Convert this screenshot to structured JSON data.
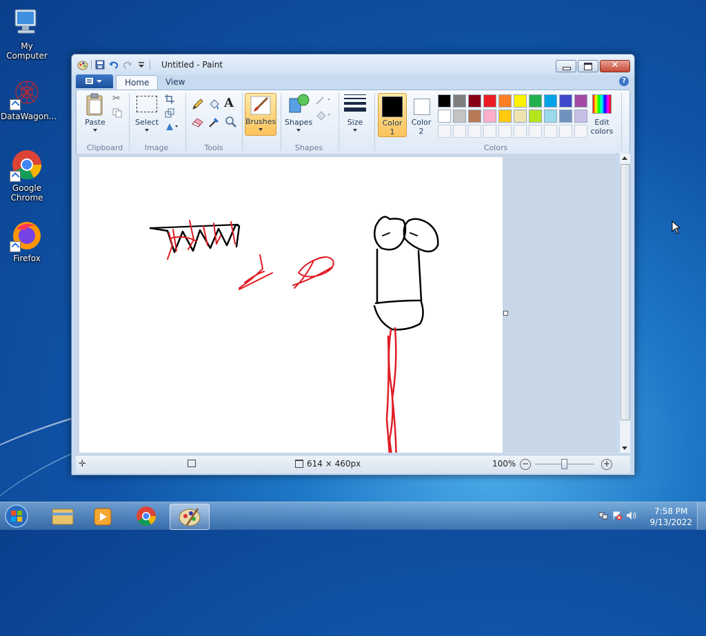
{
  "desktop": {
    "icons": [
      {
        "label": "My Computer",
        "icon": "computer-icon"
      },
      {
        "label": "DataWagon...",
        "icon": "datawagon-icon"
      },
      {
        "label": "Google Chrome",
        "icon": "chrome-icon"
      },
      {
        "label": "Firefox",
        "icon": "firefox-icon"
      }
    ]
  },
  "window": {
    "title": "Untitled - Paint",
    "tabs": [
      "Home",
      "View"
    ],
    "active_tab": "Home"
  },
  "ribbon": {
    "clipboard": {
      "paste": "Paste",
      "group": "Clipboard"
    },
    "image": {
      "select": "Select",
      "group": "Image"
    },
    "tools": {
      "group": "Tools"
    },
    "brushes": "Brushes",
    "shapes": {
      "label": "Shapes",
      "group": "Shapes"
    },
    "size": "Size",
    "color1": {
      "line1": "Color",
      "line2": "1",
      "value": "#000000"
    },
    "color2": {
      "line1": "Color",
      "line2": "2",
      "value": "#ffffff"
    },
    "colors_group": "Colors",
    "edit_colors": {
      "line1": "Edit",
      "line2": "colors"
    },
    "palette_row1": [
      "#000000",
      "#7f7f7f",
      "#880015",
      "#ed1c24",
      "#ff7f27",
      "#fff200",
      "#22b14c",
      "#00a2e8",
      "#3f48cc",
      "#a349a4"
    ],
    "palette_row2": [
      "#ffffff",
      "#c3c3c3",
      "#b97a57",
      "#ffaec9",
      "#ffc90e",
      "#efe4b0",
      "#b5e61d",
      "#99d9ea",
      "#7092be",
      "#c8bfe7"
    ]
  },
  "status": {
    "dimensions": "614 × 460px",
    "zoom": "100%"
  },
  "taskbar": {
    "items": [
      "windows-explorer-icon",
      "media-player-icon",
      "chrome-icon",
      "paint-icon"
    ],
    "active": "paint-icon",
    "time": "7:58 PM",
    "date": "9/13/2022"
  }
}
